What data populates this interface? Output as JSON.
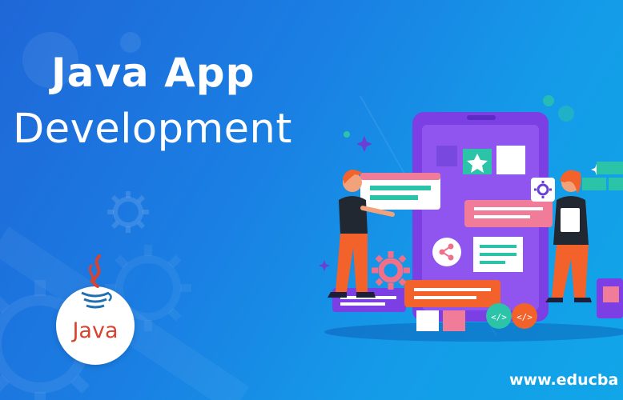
{
  "banner": {
    "title_line1": "Java App",
    "title_line2": "Development",
    "logo_text": "Java",
    "website": "www.educba",
    "colors": {
      "background_start": "#1f67d8",
      "background_end": "#11a6e8",
      "java_red": "#d8432f",
      "java_blue": "#1f6fb3",
      "phone_purple": "#7b3fe4",
      "accent_teal": "#2bc4a8",
      "accent_pink": "#f0708a",
      "accent_orange": "#f2622a"
    },
    "icons": [
      "gear-icon",
      "java-logo-icon",
      "star-icon",
      "share-icon",
      "code-icon",
      "sparkle-icon"
    ]
  }
}
